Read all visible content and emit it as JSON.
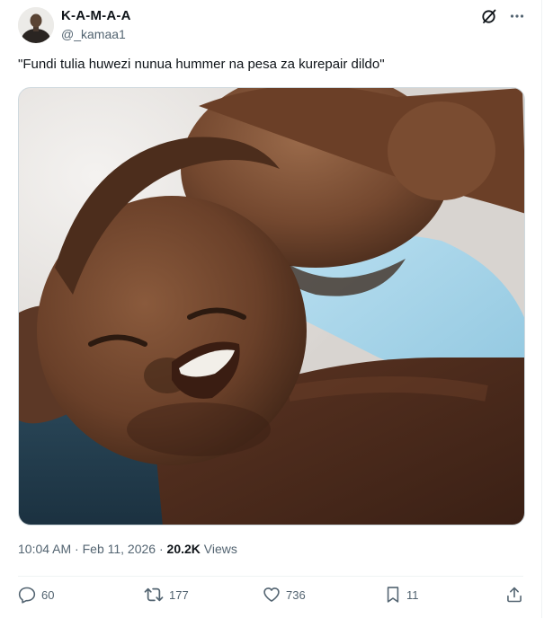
{
  "tweet": {
    "author": {
      "display_name": "K-A-M-A-A",
      "handle": "@_kamaa1",
      "avatar_icon": "user-avatar"
    },
    "header_icons": [
      "grok-icon",
      "more-icon"
    ],
    "text": "\"Fundi tulia huwezi nunua hummer na pesa za kurepair dildo\"",
    "media": {
      "kind": "photo",
      "icon": "photo-two-men-embracing"
    },
    "meta": {
      "time": "10:04 AM",
      "separator1": "·",
      "date": "Feb 11, 2026",
      "separator2": "·",
      "views_count": "20.2K",
      "views_label": "Views"
    },
    "actions": {
      "replies": "60",
      "reposts": "177",
      "likes": "736",
      "bookmarks": "11"
    }
  },
  "colors": {
    "text_primary": "#0f1419",
    "text_secondary": "#536471",
    "border": "#eff3f4",
    "media_border": "#cfd9de"
  }
}
